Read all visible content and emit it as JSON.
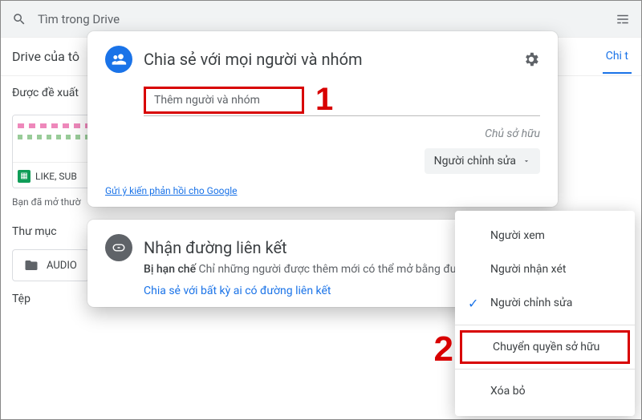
{
  "search": {
    "placeholder": "Tìm trong Drive"
  },
  "background": {
    "my_drive": "Drive của tô",
    "chi_tab": "Chi t",
    "suggested": "Được đề xuất",
    "file_label": "LIKE, SUB",
    "opened_line": "Bạn đã mở thườ",
    "folders_label": "Thư mục",
    "folder_name": "AUDIO",
    "files_label": "Tệp"
  },
  "share_dialog": {
    "title": "Chia sẻ với mọi người và nhóm",
    "input_placeholder": "Thêm người và nhóm",
    "annot1": "1",
    "owner_label": "Chủ sở hữu",
    "role_button": "Người chỉnh sửa",
    "feedback": "Gửi ý kiến phản hồi cho Google"
  },
  "link_dialog": {
    "title": "Nhận đường liên kết",
    "restricted_bold": "Bị hạn chế",
    "restricted_rest": " Chỉ những người được thêm mới có thể mở bằng đường liên kết này",
    "share_any": "Chia sẻ với bất kỳ ai có đường liên kết"
  },
  "menu": {
    "viewer": "Người xem",
    "commenter": "Người nhận xét",
    "editor": "Người chỉnh sửa",
    "transfer": "Chuyển quyền sở hữu",
    "remove": "Xóa bỏ",
    "annot2": "2"
  }
}
